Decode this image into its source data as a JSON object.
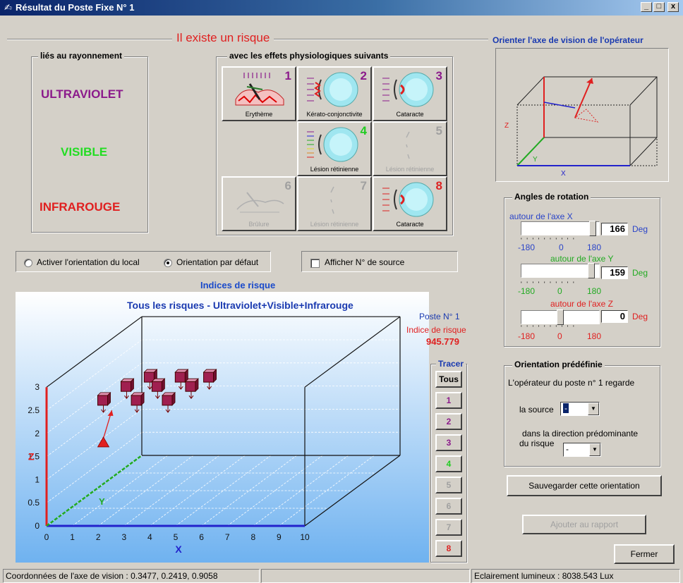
{
  "window": {
    "title": "Résultat du Poste Fixe N° 1",
    "minimize": "_",
    "maximize": "□",
    "close": "x"
  },
  "risk_header": "Il existe un risque",
  "radiation": {
    "label": "liés au rayonnement",
    "uv": "ULTRAVIOLET",
    "visible": "VISIBLE",
    "ir": "INFRAROUGE"
  },
  "effects": {
    "label": "avec les effets physiologiques suivants",
    "items": [
      {
        "num": "1",
        "label": "Erythème",
        "color": "#8b1a8b",
        "enabled": true
      },
      {
        "num": "2",
        "label": "Kérato-conjonctivite",
        "color": "#8b1a8b",
        "enabled": true
      },
      {
        "num": "3",
        "label": "Cataracte",
        "color": "#8b1a8b",
        "enabled": true
      },
      {
        "num": "4",
        "label": "Lésion rétinienne",
        "color": "#22cc22",
        "enabled": true
      },
      {
        "num": "5",
        "label": "Lésion rétinienne",
        "color": "#a0a0a0",
        "enabled": false
      },
      {
        "num": "6",
        "label": "Brûlure",
        "color": "#a0a0a0",
        "enabled": false
      },
      {
        "num": "7",
        "label": "Lésion rétinienne",
        "color": "#a0a0a0",
        "enabled": false
      },
      {
        "num": "8",
        "label": "Cataracte",
        "color": "#dd2222",
        "enabled": true
      }
    ]
  },
  "options": {
    "radio1": "Activer l'orientation du local",
    "radio2": "Orientation par défaut",
    "checkbox": "Afficher N° de source"
  },
  "indices_label": "Indices de risque",
  "chart_data": {
    "type": "scatter",
    "title": "Tous les risques - Ultraviolet+Visible+Infrarouge",
    "poste": "Poste N° 1",
    "indice_label": "Indice de risque",
    "indice_value": "945.779",
    "xlabel": "X",
    "ylabel": "Y",
    "zlabel": "Z",
    "x_ticks": [
      "0",
      "1",
      "2",
      "3",
      "4",
      "5",
      "6",
      "7",
      "8",
      "9",
      "10"
    ],
    "z_ticks": [
      "0",
      "0.5",
      "1",
      "1.5",
      "2",
      "2.5",
      "3"
    ],
    "xlim": [
      0,
      10
    ],
    "zlim": [
      0,
      3
    ],
    "points": [
      {
        "x": 2.2,
        "z": 2.7
      },
      {
        "x": 3.1,
        "z": 3.0
      },
      {
        "x": 3.5,
        "z": 2.7
      },
      {
        "x": 4.0,
        "z": 3.2
      },
      {
        "x": 4.3,
        "z": 3.0
      },
      {
        "x": 4.7,
        "z": 2.7
      },
      {
        "x": 5.2,
        "z": 3.2
      },
      {
        "x": 5.6,
        "z": 3.0
      },
      {
        "x": 6.3,
        "z": 3.2
      }
    ],
    "operator": {
      "x": 2.2,
      "z": 1.8
    }
  },
  "tracer": {
    "label": "Tracer",
    "buttons": [
      {
        "label": "Tous",
        "color": "#000000"
      },
      {
        "label": "1",
        "color": "#8b1a8b"
      },
      {
        "label": "2",
        "color": "#8b1a8b"
      },
      {
        "label": "3",
        "color": "#8b1a8b"
      },
      {
        "label": "4",
        "color": "#22cc22"
      },
      {
        "label": "5",
        "color": "#a0a0a0"
      },
      {
        "label": "6",
        "color": "#a0a0a0"
      },
      {
        "label": "7",
        "color": "#a0a0a0"
      },
      {
        "label": "8",
        "color": "#dd2222"
      }
    ]
  },
  "orient": {
    "label": "Orienter l'axe de vision de l'opérateur",
    "axes": {
      "x": "X",
      "y": "Y",
      "z": "Z"
    }
  },
  "angles": {
    "label": "Angles de rotation",
    "unit": "Deg",
    "x": {
      "label": "autour de l'axe X",
      "value": "166",
      "fraction": 0.96
    },
    "y": {
      "label": "autour de l'axe Y",
      "value": "159",
      "fraction": 0.94
    },
    "z": {
      "label": "autour de l'axe Z",
      "value": "0",
      "fraction": 0.5
    },
    "ticks": [
      "-180",
      "0",
      "180"
    ]
  },
  "predef": {
    "label": "Orientation prédéfinie",
    "line1": "L'opérateur du poste n° 1 regarde",
    "source_label": "la source",
    "source_value": "-",
    "dir_label1": "dans la direction prédominante",
    "dir_label2": "du risque",
    "dir_value": "-"
  },
  "save_btn": "Sauvegarder cette orientation",
  "report_btn": "Ajouter au rapport",
  "close_btn": "Fermer",
  "status": {
    "left": "Coordonnées de l'axe de vision : 0.3477, 0.2419, 0.9058",
    "middle": "",
    "right": "Eclairement lumineux : 8038.543 Lux"
  }
}
